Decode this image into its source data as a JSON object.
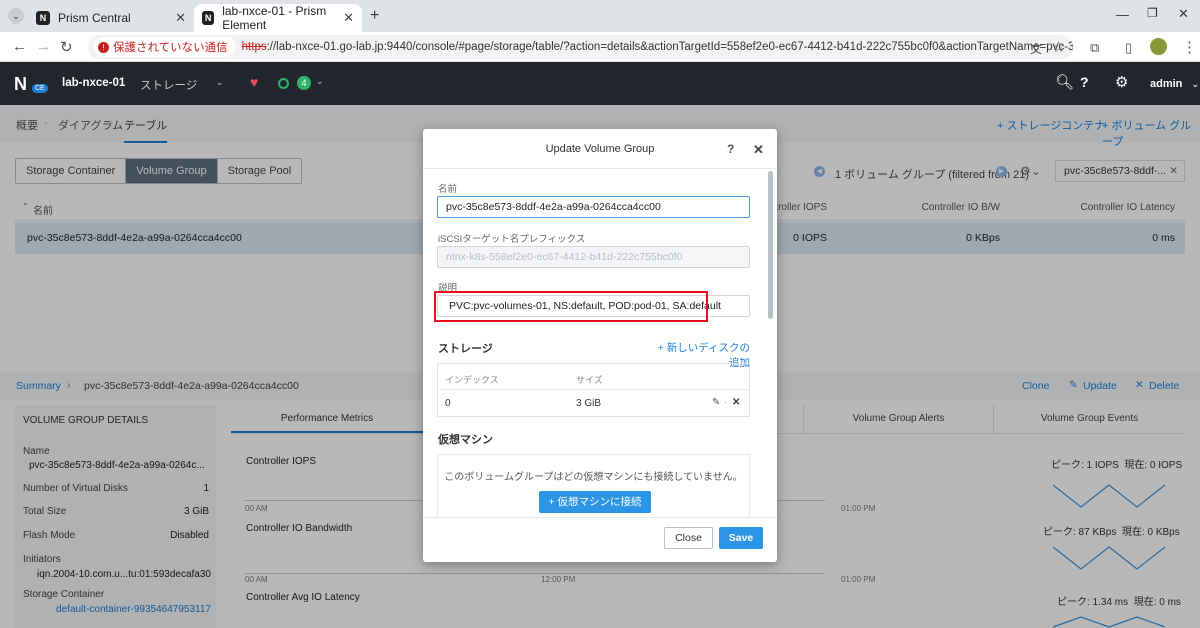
{
  "browser": {
    "tabs": [
      {
        "title": "Prism Central"
      },
      {
        "title": "lab-nxce-01 - Prism Element"
      }
    ],
    "security_warning": "保護されていない通信",
    "url_scheme": "https",
    "url_rest": "://lab-nxce-01.go-lab.jp:9440/console/#page/storage/table/?action=details&actionTargetId=558ef2e0-ec67-4412-b41d-222c755bc0f0&actionTargetName=pvc-35c8e573-8ddf-4e2a-..."
  },
  "header": {
    "logo_badge": "CE",
    "cluster": "lab-nxce-01",
    "section": "ストレージ",
    "alert_count": "4",
    "user": "admin"
  },
  "subnav": {
    "items": [
      "概要",
      "ダイアグラム",
      "テーブル"
    ],
    "actions": [
      "+ ストレージコンテナ",
      "+ ボリューム グループ"
    ]
  },
  "view_toggle": [
    "Storage Container",
    "Volume Group",
    "Storage Pool"
  ],
  "table": {
    "count_text": "1 ボリューム グループ (filtered from 21)",
    "search_value": "pvc-35c8e573-8ddf-...",
    "columns": [
      "名前",
      "Controller IOPS",
      "Controller IO B/W",
      "Controller IO Latency"
    ],
    "row": {
      "name": "pvc-35c8e573-8ddf-4e2a-a99a-0264cca4cc00",
      "iops": "0 IOPS",
      "bw": "0 KBps",
      "latency": "0 ms"
    }
  },
  "summary": {
    "breadcrumb_root": "Summary",
    "breadcrumb_item": "pvc-35c8e573-8ddf-4e2a-a99a-0264cca4cc00",
    "actions": [
      "Clone",
      "Update",
      "Delete"
    ]
  },
  "details": {
    "title": "VOLUME GROUP DETAILS",
    "name_label": "Name",
    "name_value": "pvc-35c8e573-8ddf-4e2a-a99a-0264c...",
    "disks_label": "Number of Virtual Disks",
    "disks_value": "1",
    "size_label": "Total Size",
    "size_value": "3 GiB",
    "flash_label": "Flash Mode",
    "flash_value": "Disabled",
    "initiators_label": "Initiators",
    "initiators_value": "iqn.2004-10.com.u...tu:01:593decafa30",
    "container_label": "Storage Container",
    "container_value": "default-container-99354647953117"
  },
  "metrics": {
    "tabs": [
      "Performance Metrics",
      "Volume Group Alerts",
      "Volume Group Events"
    ],
    "charts": [
      {
        "title": "Controller IOPS",
        "peak": "ピーク: 1 IOPS",
        "current": "現在: 0 IOPS"
      },
      {
        "title": "Controller IO Bandwidth",
        "peak": "ピーク: 87 KBps",
        "current": "現在: 0 KBps"
      },
      {
        "title": "Controller Avg IO Latency",
        "peak": "ピーク: 1.34 ms",
        "current": "現在: 0 ms"
      }
    ],
    "time_labels": [
      "00 AM",
      "12:00 PM",
      "01:00 PM"
    ]
  },
  "modal": {
    "title": "Update Volume Group",
    "help": "?",
    "name_label": "名前",
    "name_value": "pvc-35c8e573-8ddf-4e2a-a99a-0264cca4cc00",
    "iscsi_label": "iSCSIターゲット名プレフィックス",
    "iscsi_value": "ntnx-k8s-558ef2e0-ec67-4412-b41d-222c755bc0f0",
    "desc_label": "説明",
    "desc_value": "PVC:pvc-volumes-01, NS:default, POD:pod-01, SA:default",
    "storage_title": "ストレージ",
    "add_disk": "+ 新しいディスクの追加",
    "disk_cols": [
      "インデックス",
      "サイズ"
    ],
    "disk_row": {
      "index": "0",
      "size": "3 GiB"
    },
    "vm_title": "仮想マシン",
    "vm_empty": "このボリュームグループはどの仮想マシンにも接続していません。",
    "vm_connect": "+ 仮想マシンに接続",
    "close": "Close",
    "save": "Save"
  },
  "colors": {
    "accent": "#1c7ed6",
    "highlight": "#e8101a",
    "header_bg": "#22272e"
  }
}
